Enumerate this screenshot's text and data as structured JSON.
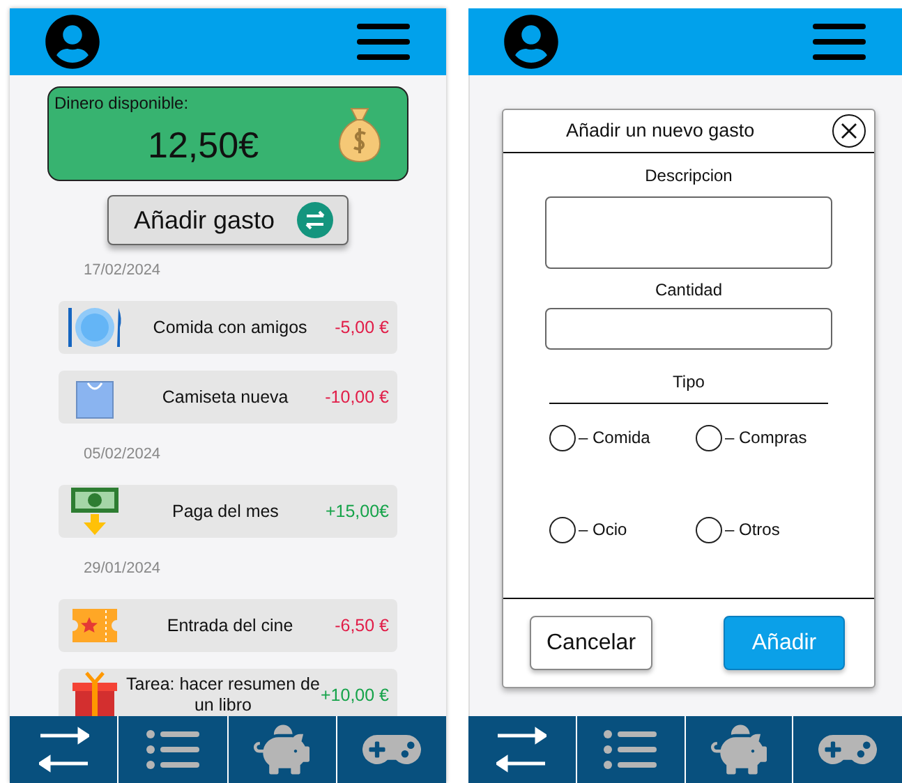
{
  "list_screen": {
    "balance": {
      "label": "Dinero disponible:",
      "amount": "12,50€"
    },
    "add_button": "Añadir gasto",
    "groups": [
      {
        "date": "17/02/2024",
        "items": [
          {
            "label": "Comida con amigos",
            "amount": "-5,00 €",
            "kind": "expense"
          },
          {
            "label": "Camiseta nueva",
            "amount": "-10,00 €",
            "kind": "expense"
          }
        ]
      },
      {
        "date": "05/02/2024",
        "items": [
          {
            "label": "Paga del mes",
            "amount": "+15,00€",
            "kind": "income"
          }
        ]
      },
      {
        "date": "29/01/2024",
        "items": [
          {
            "label": "Entrada del cine",
            "amount": "-6,50 €",
            "kind": "expense"
          },
          {
            "label": "Tarea: hacer resumen de un libro",
            "amount": "+10,00 €",
            "kind": "income"
          }
        ]
      }
    ]
  },
  "form_screen": {
    "dialog": {
      "title": "Añadir un nuevo gasto",
      "description_label": "Descripcion",
      "amount_label": "Cantidad",
      "type_label": "Tipo",
      "options": [
        {
          "label": "– Comida",
          "selected": false
        },
        {
          "label": "– Compras",
          "selected": false
        },
        {
          "label": "– Ocio",
          "selected": false
        },
        {
          "label": "– Otros",
          "selected": false
        }
      ],
      "cancel": "Cancelar",
      "submit": "Añadir"
    }
  }
}
